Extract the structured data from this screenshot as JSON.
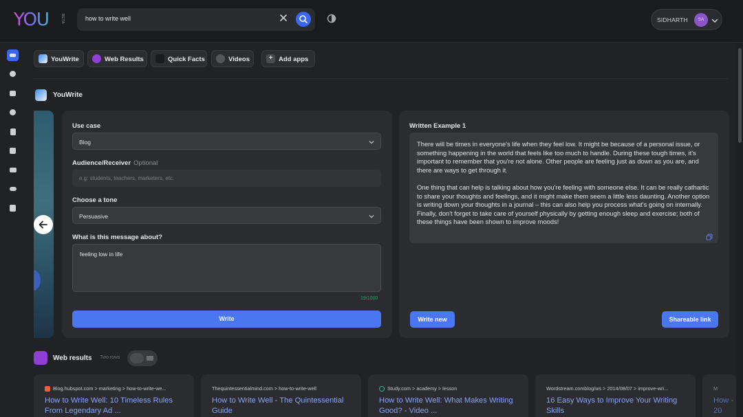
{
  "header": {
    "logo_text": "YOU",
    "logo_badge": "BETA",
    "search_value": "how to write well",
    "clear_icon": "close-icon",
    "search_icon": "search-icon",
    "privacy_icon": "shield-icon",
    "user_name": "SIDHARTH",
    "user_initials": "SA"
  },
  "rail": {
    "items": [
      {
        "name": "rail-all-icon",
        "active": true
      },
      {
        "name": "rail-web-icon"
      },
      {
        "name": "rail-images-icon"
      },
      {
        "name": "rail-videos-icon"
      },
      {
        "name": "rail-news-icon"
      },
      {
        "name": "rail-maps-icon"
      },
      {
        "name": "rail-chat-icon"
      },
      {
        "name": "rail-social-icon"
      },
      {
        "name": "rail-shopping-icon"
      }
    ]
  },
  "app_tabs": [
    {
      "label": "YouWrite"
    },
    {
      "label": "Web Results"
    },
    {
      "label": "Quick Facts"
    },
    {
      "label": "Videos"
    },
    {
      "label": "Add apps"
    }
  ],
  "youwrite": {
    "title": "YouWrite",
    "use_case_label": "Use case",
    "use_case_value": "Blog",
    "audience_label": "Audience/Receiver",
    "audience_optional": "Optional",
    "audience_placeholder": "e.g: students, teachers, marketers, etc.",
    "tone_label": "Choose a tone",
    "tone_value": "Persuasive",
    "message_label": "What is this message about?",
    "message_value": "feeling low in life",
    "char_count": "19/1000",
    "write_button": "Write",
    "example_title": "Written Example 1",
    "example_paragraph_1": "There will be times in everyone's life when they feel low. It might be because of a personal issue, or something happening in the world that feels like too much to handle. During these tough times, it's important to remember that you're not alone. Other people are feeling just as down as you are, and there are ways to get through it.",
    "example_paragraph_2": "One thing that can help is talking about how you're feeling with someone else. It can be really cathartic to share your thoughts and feelings, and it might make them seem a little less daunting. Another option is writing down your thoughts in a journal – this can also help you process what's going on internally. Finally, don't forget to take care of yourself physically by getting enough sleep and exercise; both of these things have been shown to improve moods!",
    "write_new_button": "Write new",
    "share_button": "Shareable link"
  },
  "web_results": {
    "title": "Web results",
    "layout_label": "Two rows",
    "results": [
      {
        "crumb": "Blog.hubspot.com > marketing > how-to-write-we...",
        "title": "How to Write Well: 10 Timeless Rules From Legendary Ad ..."
      },
      {
        "crumb": "Thequintessentialmind.com > how-to-write-well",
        "title": "How to Write Well - The Quintessential Guide"
      },
      {
        "crumb": "Study.com > academy > lesson",
        "title": "How to Write Well: What Makes Writing Good? - Video ..."
      },
      {
        "crumb": "Wordstream.comblog/ws > 2014/08/07 > improve-wri...",
        "title": "16 Easy Ways to Improve Your Writing Skills"
      },
      {
        "crumb": "M",
        "title": "How - 20"
      }
    ]
  },
  "colors": {
    "accent": "#4a76f0",
    "background": "#212224",
    "card": "#2b2c2f",
    "link": "#8aa4f6",
    "counter": "#2aa36a"
  }
}
